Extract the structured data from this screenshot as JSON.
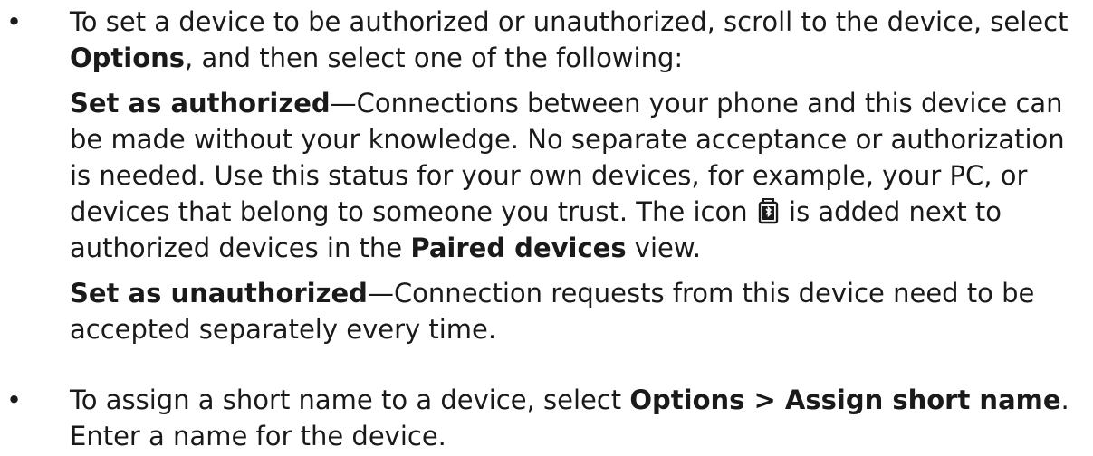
{
  "bullets": {
    "symbol": "•"
  },
  "item1": {
    "intro_a": "To set a device to be authorized or unauthorized, scroll to the device, select ",
    "intro_options": "Options",
    "intro_b": ", and then select one of the following:",
    "authorized_term": "Set as authorized",
    "authorized_a": "—Connections between your phone and this device can be made without your knowledge. No separate acceptance or authorization is needed. Use this status for your own devices, for example, your PC, or devices that belong to someone you trust. The icon ",
    "authorized_b": " is added next to authorized devices in the ",
    "paired_devices": "Paired devices",
    "authorized_c": " view.",
    "unauthorized_term": "Set as unauthorized",
    "unauthorized_text": "—Connection requests from this device need to be accepted separately every time."
  },
  "item2": {
    "text_a": "To assign a short name to a device, select ",
    "menu_path": "Options > Assign short name",
    "text_b": ". Enter a name for the device."
  },
  "icons": {
    "authorized": "authorized-device-icon"
  }
}
